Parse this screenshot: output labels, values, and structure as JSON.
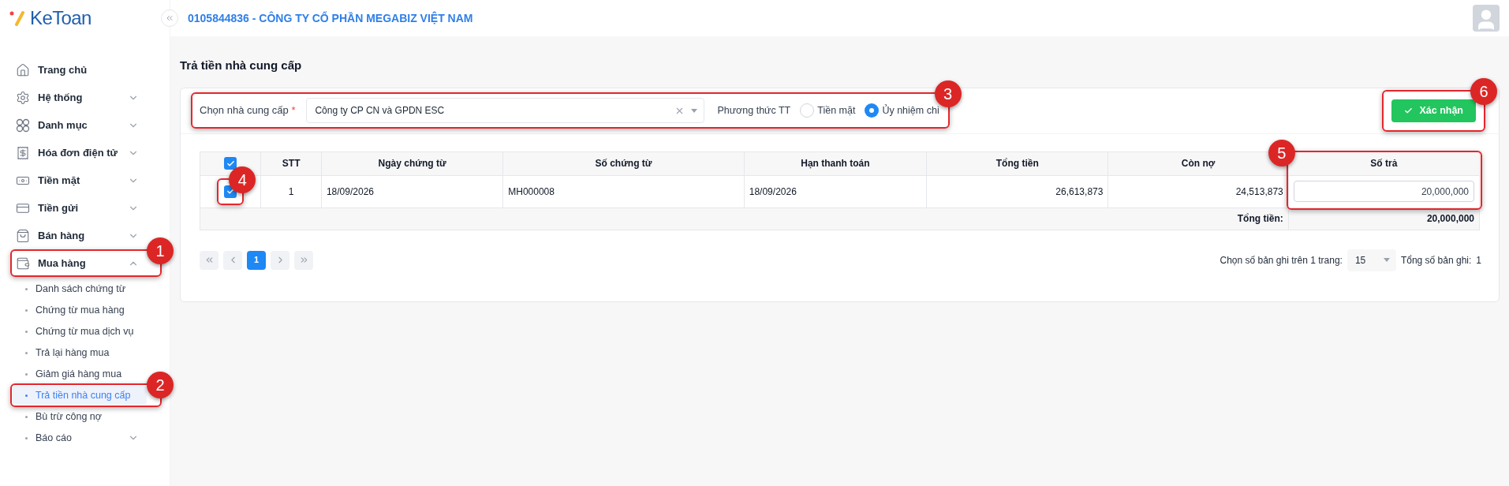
{
  "logo": {
    "text": "KeToan"
  },
  "company": "0105844836 - CÔNG TY CỔ PHẦN MEGABIZ VIỆT NAM",
  "sidebar": {
    "items": [
      {
        "label": "Trang chủ",
        "kind": "home"
      },
      {
        "label": "Hệ thống",
        "kind": "settings",
        "expanded": false
      },
      {
        "label": "Danh mục",
        "kind": "catalog",
        "expanded": false
      },
      {
        "label": "Hóa đơn điện tử",
        "kind": "invoice",
        "expanded": false
      },
      {
        "label": "Tiền mặt",
        "kind": "cash",
        "expanded": false
      },
      {
        "label": "Tiền gửi",
        "kind": "deposit",
        "expanded": false
      },
      {
        "label": "Bán hàng",
        "kind": "sales",
        "expanded": false
      },
      {
        "label": "Mua hàng",
        "kind": "purchase",
        "expanded": true,
        "annotation": "1",
        "children": [
          {
            "label": "Danh sách chứng từ",
            "selected": false
          },
          {
            "label": "Chứng từ mua hàng",
            "selected": false
          },
          {
            "label": "Chứng từ mua dịch vụ",
            "selected": false
          },
          {
            "label": "Trả lại hàng mua",
            "selected": false
          },
          {
            "label": "Giảm giá hàng mua",
            "selected": false
          },
          {
            "label": "Trả tiền nhà cung cấp",
            "selected": true,
            "annotation": "2"
          },
          {
            "label": "Bù trừ công nợ",
            "selected": false
          },
          {
            "label": "Báo cáo",
            "selected": false,
            "expanded": false
          }
        ]
      }
    ]
  },
  "page_title": "Trả tiền nhà cung cấp",
  "filter": {
    "annotation": "3",
    "supplier_label": "Chọn nhà cung cấp",
    "required_mark": "*",
    "supplier_value": "Công ty CP CN và GPDN ESC",
    "payment_label": "Phương thức TT",
    "payment_options": [
      {
        "label": "Tiền mặt",
        "selected": false
      },
      {
        "label": "Ủy nhiệm chi",
        "selected": true
      }
    ]
  },
  "confirm_button": {
    "label": "Xác nhận",
    "annotation": "6"
  },
  "table": {
    "header_checked": true,
    "pay_annotation": "5",
    "columns": [
      "STT",
      "Ngày chứng từ",
      "Số chứng từ",
      "Hạn thanh toán",
      "Tổng tiền",
      "Còn nợ",
      "Số trả"
    ],
    "rows": [
      {
        "checked": true,
        "annotation": "4",
        "cells": [
          "1",
          "18/09/2026",
          "MH000008",
          "18/09/2026",
          "26,613,873",
          "24,513,873"
        ],
        "pay": "20,000,000"
      }
    ],
    "total_label": "Tổng tiền:",
    "total_value": "20,000,000"
  },
  "pagination": {
    "pages": [
      {
        "label": "1",
        "selected": true
      }
    ],
    "page_size_label": "Chọn số bản ghi trên 1 trang:",
    "page_size": "15",
    "total_label": "Tổng số bản ghi:",
    "total_value": "1"
  }
}
